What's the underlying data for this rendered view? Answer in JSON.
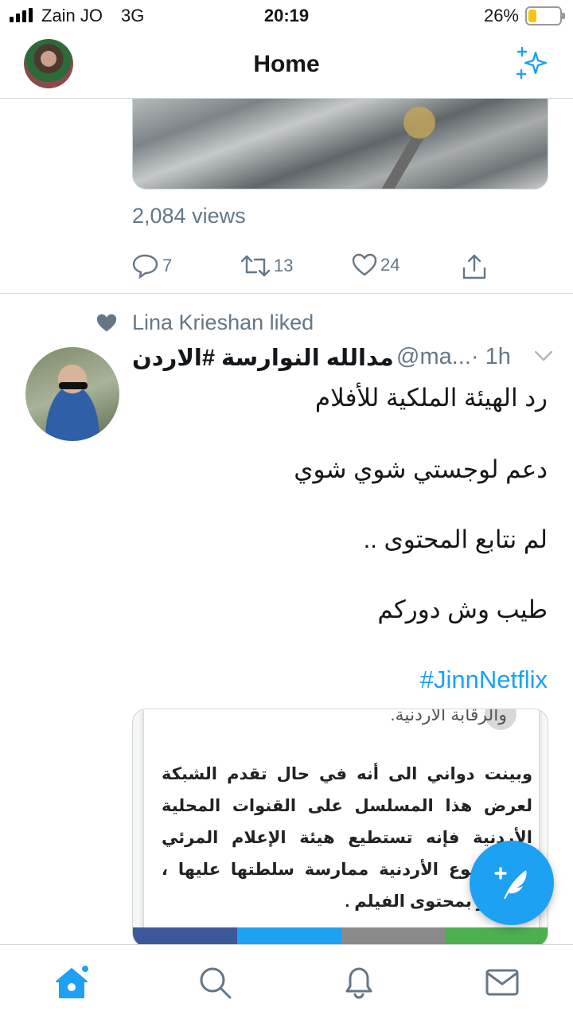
{
  "status_bar": {
    "carrier": "Zain JO",
    "network": "3G",
    "time": "20:19",
    "battery": "26%",
    "battery_level": 0.26
  },
  "header": {
    "title": "Home"
  },
  "previous_tweet": {
    "views": "2,084 views",
    "replies": "7",
    "retweets": "13",
    "likes": "24"
  },
  "tweet": {
    "social_context": "Lina Krieshan liked",
    "author_name": "مدالله النوارسة #الاردن",
    "handle": "@ma...",
    "time": "· 1h",
    "lines": [
      "رد  الهيئة  الملكية  للأفلام",
      "دعم  لوجستي  شوي  شوي",
      "لم نتابع المحتوى ..",
      "طيب وش دوركم"
    ],
    "hashtag": "#JinnNetflix",
    "card": {
      "cut_text": "والرقابة الأردنية.",
      "article": "وبينت دواني الى أنه في حال تقدم الشبكة لعرض هذا المسلسل على القنوات المحلية الأردنية فإنه تستطيع هيئة الإعلام المرئي والمسموع الأردنية ممارسة سلطتها عليها ، والنظر بمحتوى الفيلم ."
    }
  },
  "colors": {
    "accent": "#1da1f2",
    "secondary_text": "#657786",
    "divider": "#d0d7dc"
  }
}
